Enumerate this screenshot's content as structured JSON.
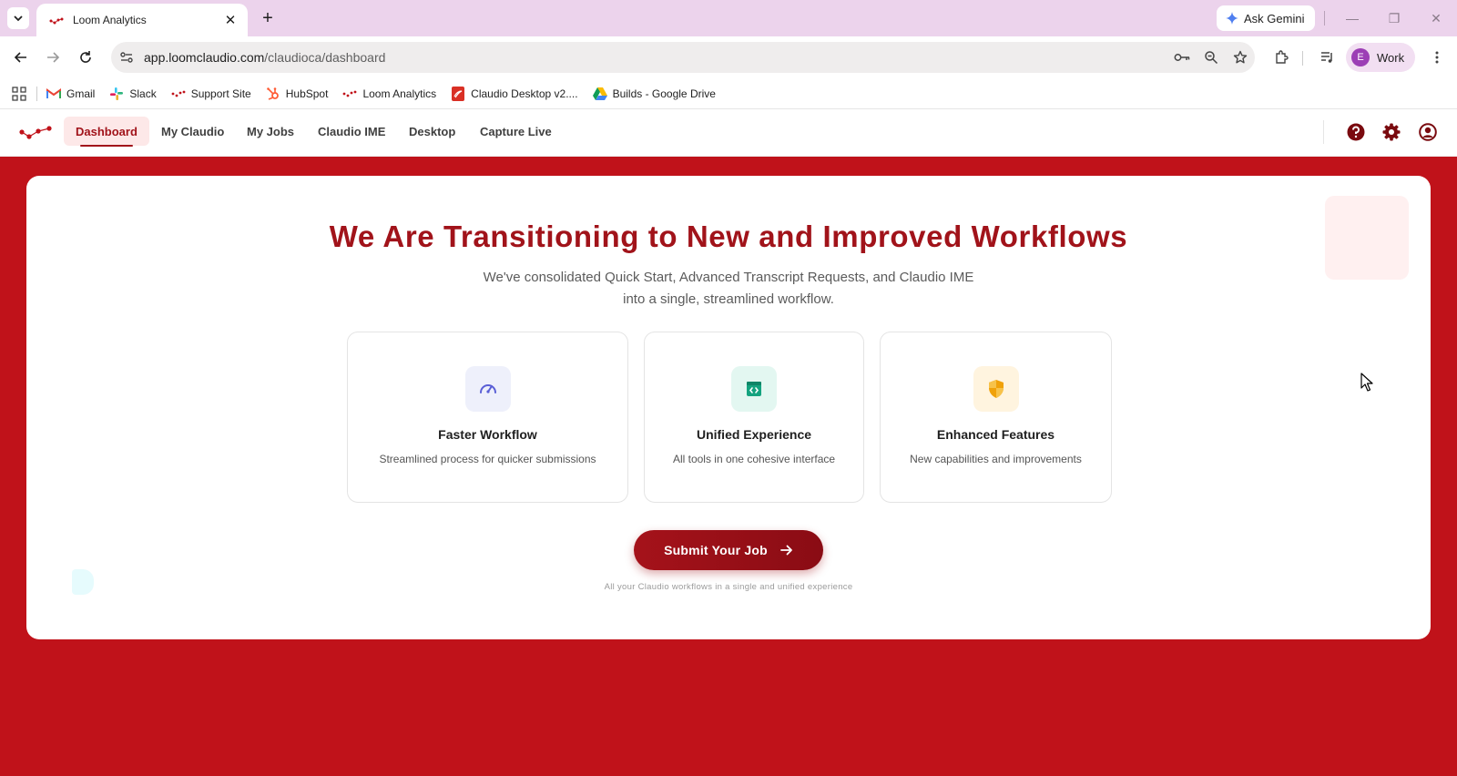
{
  "browser": {
    "tab": {
      "title": "Loom Analytics",
      "close_icon": "✕"
    },
    "new_tab_icon": "+",
    "gemini_label": "Ask Gemini",
    "window_controls": {
      "minimize": "—",
      "restore": "❐",
      "close": "✕"
    },
    "url": {
      "host": "app.loomclaudio.com",
      "path": "/claudioca/dashboard"
    },
    "profile": {
      "initial": "E",
      "label": "Work"
    }
  },
  "bookmarks": [
    {
      "label": "Gmail",
      "icon": "gmail-icon"
    },
    {
      "label": "Slack",
      "icon": "slack-icon"
    },
    {
      "label": "Support Site",
      "icon": "loom-icon"
    },
    {
      "label": "HubSpot",
      "icon": "hubspot-icon"
    },
    {
      "label": "Loom Analytics",
      "icon": "loom-icon"
    },
    {
      "label": "Claudio Desktop v2....",
      "icon": "pdf-icon"
    },
    {
      "label": "Builds - Google Drive",
      "icon": "drive-icon"
    }
  ],
  "nav": {
    "items": [
      {
        "label": "Dashboard",
        "active": true
      },
      {
        "label": "My Claudio"
      },
      {
        "label": "My Jobs"
      },
      {
        "label": "Claudio IME"
      },
      {
        "label": "Desktop"
      },
      {
        "label": "Capture Live"
      }
    ],
    "icons": [
      "help-icon",
      "settings-icon",
      "account-icon"
    ]
  },
  "main": {
    "headline": "We Are Transitioning to New and Improved Workflows",
    "subline_1": "We've consolidated Quick Start, Advanced Transcript Requests, and Claudio IME",
    "subline_2": "into a single, streamlined workflow.",
    "features": [
      {
        "title": "Faster Workflow",
        "description": "Streamlined process for quicker submissions",
        "icon": "speedometer-icon",
        "tint": "#eef0fb",
        "color": "#5a5fd6"
      },
      {
        "title": "Unified Experience",
        "description": "All tools in one cohesive interface",
        "icon": "code-window-icon",
        "tint": "#e3f7f1",
        "color": "#14a37f"
      },
      {
        "title": "Enhanced Features",
        "description": "New capabilities and improvements",
        "icon": "shield-icon",
        "tint": "#fff4df",
        "color": "#f0a10a"
      }
    ],
    "submit_label": "Submit Your Job",
    "tagline": "All your Claudio workflows in a single and unified experience"
  },
  "colors": {
    "brand": "#a1131a",
    "page_background": "#c0121a",
    "tabstrip": "#ecd3ec"
  }
}
